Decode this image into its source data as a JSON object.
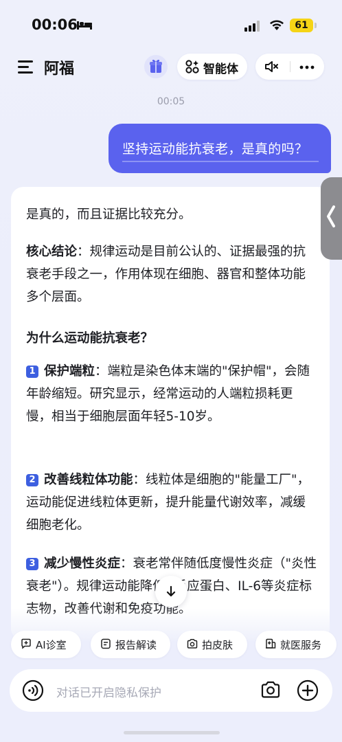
{
  "status_bar": {
    "time": "00:06",
    "battery": "61"
  },
  "header": {
    "title": "阿福",
    "agent_label": "智能体"
  },
  "chat": {
    "timestamp": "00:05",
    "user_message": "坚持运动能抗衰老，是真的吗？",
    "answer": {
      "intro": "是真的，而且证据比较充分。",
      "core_label": "核心结论",
      "core_text": "：规律运动是目前公认的、证据最强的抗衰老手段之一，作用体现在细胞、器官和整体功能多个层面。",
      "question": "为什么运动能抗衰老？",
      "points": [
        {
          "num": "1",
          "title": "保护端粒",
          "text": "：端粒是染色体末端的\"保护帽\"，会随年龄缩短。研究显示，经常运动的人端粒损耗更慢，相当于细胞层面年轻5-10岁。"
        },
        {
          "num": "2",
          "title": "改善线粒体功能",
          "text": "：线粒体是细胞的\"能量工厂\"，运动能促进线粒体更新，提升能量代谢效率，减缓细胞老化。"
        },
        {
          "num": "3",
          "title": "减少慢性炎症",
          "text": "：衰老常伴随低度慢性炎症（\"炎性衰老\"）。规律运动能降低C反应蛋白、IL-6等炎症标志物，改善代谢和免疫功能。"
        }
      ]
    }
  },
  "chips": [
    {
      "label": "AI诊室",
      "icon": "chat-cross-icon"
    },
    {
      "label": "报告解读",
      "icon": "document-icon"
    },
    {
      "label": "拍皮肤",
      "icon": "camera-icon"
    },
    {
      "label": "就医服务",
      "icon": "hospital-icon"
    }
  ],
  "input": {
    "placeholder": "对话已开启隐私保护"
  },
  "colors": {
    "accent": "#5a62ee",
    "number_badge": "#3d5fe0",
    "battery": "#f5d416"
  }
}
